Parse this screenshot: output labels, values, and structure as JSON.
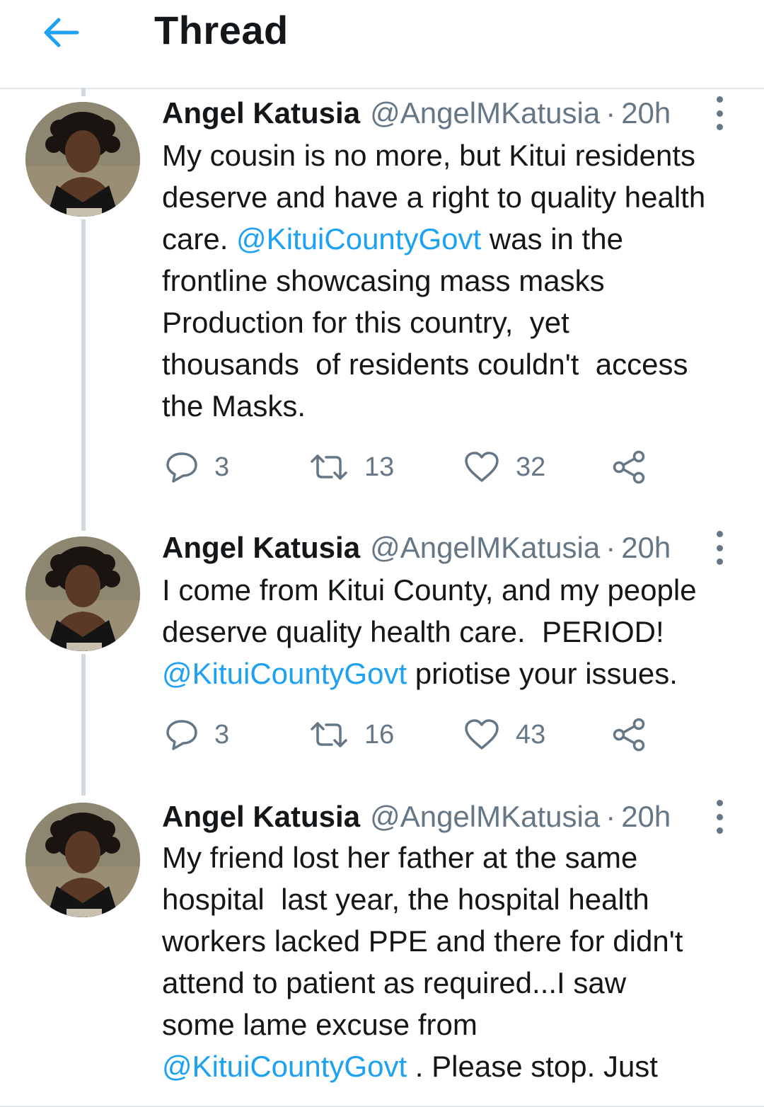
{
  "header": {
    "title": "Thread",
    "back_icon": "arrow-left-icon",
    "accent": "#1da1f2"
  },
  "tweets": [
    {
      "name": "Angel Katusia",
      "handle": "@AngelMKatusia",
      "separator": "·",
      "time": "20h",
      "lines": [
        [
          {
            "t": "My cousin is no more, but Kitui residents"
          }
        ],
        [
          {
            "t": "deserve and have a right to quality health"
          }
        ],
        [
          {
            "t": "care. "
          },
          {
            "t": "@KituiCountyGovt",
            "m": true
          },
          {
            "t": " was in the"
          }
        ],
        [
          {
            "t": "frontline showcasing mass masks"
          }
        ],
        [
          {
            "t": "Production for this country,  yet"
          }
        ],
        [
          {
            "t": "thousands  of residents couldn't  access"
          }
        ],
        [
          {
            "t": "the Masks."
          }
        ]
      ],
      "replies": "3",
      "retweets": "13",
      "likes": "32"
    },
    {
      "name": "Angel Katusia",
      "handle": "@AngelMKatusia",
      "separator": "·",
      "time": "20h",
      "lines": [
        [
          {
            "t": "I come from Kitui County, and my people"
          }
        ],
        [
          {
            "t": "deserve quality health care.  PERIOD!"
          }
        ],
        [
          {
            "t": "@KituiCountyGovt",
            "m": true
          },
          {
            "t": " priotise your issues."
          }
        ]
      ],
      "replies": "3",
      "retweets": "16",
      "likes": "43"
    },
    {
      "name": "Angel Katusia",
      "handle": "@AngelMKatusia",
      "separator": "·",
      "time": "20h",
      "lines": [
        [
          {
            "t": "My friend lost her father at the same"
          }
        ],
        [
          {
            "t": "hospital  last year, the hospital health"
          }
        ],
        [
          {
            "t": "workers lacked PPE and there for didn't"
          }
        ],
        [
          {
            "t": "attend to patient as required...I saw"
          }
        ],
        [
          {
            "t": "some lame excuse from"
          }
        ],
        [
          {
            "t": "@KituiCountyGovt",
            "m": true
          },
          {
            "t": " . Please stop. Just"
          }
        ]
      ]
    }
  ]
}
